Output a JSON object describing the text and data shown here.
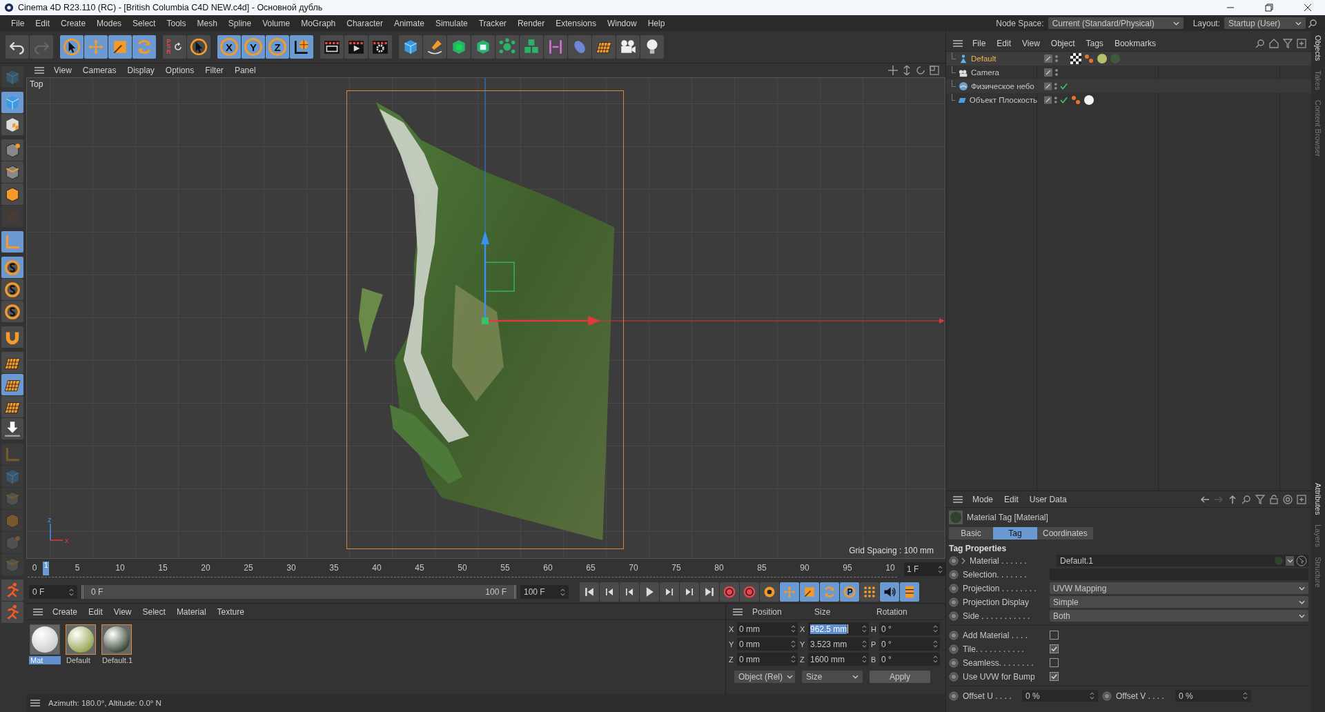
{
  "window": {
    "title": "Cinema 4D R23.110 (RC) - [British Columbia C4D NEW.c4d] - Основной дубль"
  },
  "menu": [
    "File",
    "Edit",
    "Create",
    "Modes",
    "Select",
    "Tools",
    "Mesh",
    "Spline",
    "Volume",
    "MoGraph",
    "Character",
    "Animate",
    "Simulate",
    "Tracker",
    "Render",
    "Extensions",
    "Window",
    "Help"
  ],
  "node_space": {
    "label": "Node Space:",
    "value": "Current (Standard/Physical)"
  },
  "layout": {
    "label": "Layout:",
    "value": "Startup (User)"
  },
  "toolbar": [
    [
      {
        "kind": "undo",
        "selected": false
      },
      {
        "kind": "redo",
        "selected": false
      }
    ],
    [
      {
        "kind": "cursor",
        "selected": true
      },
      {
        "kind": "move",
        "selected": true
      },
      {
        "kind": "scale",
        "selected": true
      },
      {
        "kind": "rotate",
        "selected": true
      }
    ],
    [
      {
        "kind": "psr",
        "label": "PSR",
        "selected": false
      },
      {
        "kind": "cursor",
        "selected": false
      }
    ],
    [
      {
        "kind": "axis",
        "label": "X",
        "selected": true
      },
      {
        "kind": "axis",
        "label": "Y",
        "selected": true
      },
      {
        "kind": "axis",
        "label": "Z",
        "selected": true
      },
      {
        "kind": "globe",
        "selected": true
      }
    ],
    [
      {
        "kind": "clapper",
        "selected": false
      },
      {
        "kind": "play-clapper",
        "selected": false
      },
      {
        "kind": "gear-clapper",
        "selected": false
      }
    ],
    [
      {
        "kind": "cube",
        "selected": false
      },
      {
        "kind": "pen",
        "selected": false
      },
      {
        "kind": "cube-frame",
        "selected": false
      },
      {
        "kind": "green-box",
        "selected": false
      },
      {
        "kind": "nodes",
        "selected": false
      },
      {
        "kind": "cubes",
        "selected": false
      },
      {
        "kind": "bar",
        "selected": false
      },
      {
        "kind": "blob",
        "selected": false
      },
      {
        "kind": "grid",
        "selected": false
      },
      {
        "kind": "camera",
        "selected": false
      },
      {
        "kind": "bulb",
        "selected": false
      }
    ]
  ],
  "left_toolbar": [
    [
      {
        "kind": "cube",
        "selected": false,
        "disabled": true
      }
    ],
    [
      {
        "kind": "cube",
        "selected": true,
        "disabled": false
      },
      {
        "kind": "checker",
        "selected": false,
        "disabled": false
      }
    ],
    [
      {
        "kind": "point",
        "selected": false,
        "disabled": false
      },
      {
        "kind": "edge",
        "selected": false,
        "disabled": false
      },
      {
        "kind": "face",
        "selected": false,
        "disabled": false
      },
      {
        "kind": "uv",
        "selected": false,
        "disabled": true
      }
    ],
    [
      {
        "kind": "axis",
        "selected": true,
        "disabled": false
      }
    ],
    [
      {
        "kind": "snap",
        "selected": true,
        "disabled": false
      },
      {
        "kind": "snap",
        "selected": false,
        "disabled": false
      },
      {
        "kind": "snap",
        "selected": false,
        "disabled": false
      }
    ],
    [
      {
        "kind": "magnet",
        "selected": false,
        "disabled": false
      }
    ],
    [
      {
        "kind": "grid",
        "selected": false,
        "disabled": false
      },
      {
        "kind": "grid",
        "selected": true,
        "disabled": false
      },
      {
        "kind": "grid",
        "selected": false,
        "disabled": false
      },
      {
        "kind": "drop",
        "selected": false,
        "disabled": false
      }
    ],
    [
      {
        "kind": "axis",
        "selected": false,
        "disabled": true
      },
      {
        "kind": "cube",
        "selected": false,
        "disabled": true
      },
      {
        "kind": "edge",
        "selected": false,
        "disabled": true
      },
      {
        "kind": "face",
        "selected": false,
        "disabled": true
      },
      {
        "kind": "point",
        "selected": false,
        "disabled": true
      },
      {
        "kind": "edge",
        "selected": false,
        "disabled": true
      }
    ],
    [
      {
        "kind": "runner",
        "selected": false,
        "disabled": false
      },
      {
        "kind": "runner",
        "selected": false,
        "disabled": false
      }
    ]
  ],
  "viewport": {
    "menu": [
      "View",
      "Cameras",
      "Display",
      "Options",
      "Filter",
      "Panel"
    ],
    "name": "Top",
    "grid_spacing": "Grid Spacing : 100 mm",
    "axis_labels": [
      "z",
      "x"
    ]
  },
  "timeline": {
    "ticks": [
      "0",
      "5",
      "10",
      "15",
      "20",
      "25",
      "30",
      "35",
      "40",
      "45",
      "50",
      "55",
      "60",
      "65",
      "70",
      "75",
      "80",
      "85",
      "90",
      "95",
      "10"
    ],
    "current": "1",
    "current_field": "1 F",
    "start": "0 F",
    "range_start": "0 F",
    "range_end": "100 F",
    "level": 1,
    "end": "100 F",
    "transport": [
      {
        "kind": "first",
        "selected": false
      },
      {
        "kind": "prev-key",
        "selected": false
      },
      {
        "kind": "prev",
        "selected": false
      },
      {
        "kind": "play",
        "selected": false
      },
      {
        "kind": "next",
        "selected": false
      },
      {
        "kind": "next-key",
        "selected": false
      },
      {
        "kind": "last",
        "selected": false
      },
      {
        "kind": "record",
        "selected": false
      },
      {
        "kind": "auto-key",
        "selected": false
      },
      {
        "kind": "key-gear",
        "selected": false
      },
      {
        "kind": "key-move",
        "selected": true
      },
      {
        "kind": "key-scale",
        "selected": true
      },
      {
        "kind": "key-rotate",
        "selected": true
      },
      {
        "kind": "key-p",
        "selected": true
      },
      {
        "kind": "key-dots",
        "selected": false
      },
      {
        "kind": "sound",
        "selected": true
      },
      {
        "kind": "film",
        "selected": true
      }
    ]
  },
  "materials": {
    "menu": [
      "Create",
      "Edit",
      "View",
      "Select",
      "Material",
      "Texture"
    ],
    "items": [
      {
        "name": "Mat",
        "kind": "white",
        "selected": true,
        "in_use": false
      },
      {
        "name": "Default",
        "kind": "yellow",
        "selected": false,
        "in_use": true
      },
      {
        "name": "Default.1",
        "kind": "green",
        "selected": false,
        "in_use": true
      }
    ]
  },
  "coordinates": {
    "headers": [
      "Position",
      "Size",
      "Rotation"
    ],
    "rows": [
      [
        {
          "axis": "X",
          "value": "0 mm",
          "focused": false
        },
        {
          "axis": "X",
          "value": "962.5 mm",
          "focused": true
        },
        {
          "axis": "H",
          "value": "0 °",
          "focused": false
        }
      ],
      [
        {
          "axis": "Y",
          "value": "0 mm",
          "focused": false
        },
        {
          "axis": "Y",
          "value": "3.523 mm",
          "focused": false
        },
        {
          "axis": "P",
          "value": "0 °",
          "focused": false
        }
      ],
      [
        {
          "axis": "Z",
          "value": "0 mm",
          "focused": false
        },
        {
          "axis": "Z",
          "value": "1600 mm",
          "focused": false
        },
        {
          "axis": "B",
          "value": "0 °",
          "focused": false
        }
      ]
    ],
    "mode": "Object (Rel)",
    "size_mode": "Size",
    "apply": "Apply"
  },
  "objects": {
    "menu": [
      "File",
      "Edit",
      "View",
      "Object",
      "Tags",
      "Bookmarks"
    ],
    "items": [
      {
        "name": "Default",
        "kind": "figure",
        "selected": true,
        "checked": false,
        "tags": [
          {
            "kind": "checker"
          },
          {
            "kind": "dots"
          },
          {
            "kind": "yellow"
          },
          {
            "kind": "green"
          }
        ]
      },
      {
        "name": "Camera",
        "kind": "camera",
        "selected": false,
        "checked": false
      },
      {
        "name": "Физическое небо",
        "kind": "sky",
        "selected": false,
        "checked": true
      },
      {
        "name": "Объект Плоскость",
        "kind": "plane",
        "selected": false,
        "checked": true,
        "tags": [
          {
            "kind": "dots"
          },
          {
            "kind": "white"
          }
        ]
      }
    ]
  },
  "attributes": {
    "menu": [
      "Mode",
      "Edit",
      "User Data"
    ],
    "title": "Material Tag [Material]",
    "tabs": [
      {
        "label": "Basic",
        "selected": false
      },
      {
        "label": "Tag",
        "selected": true
      },
      {
        "label": "Coordinates",
        "selected": false
      }
    ],
    "section": "Tag Properties",
    "fields": [
      {
        "kind": "link",
        "label": "Material . . . . . .",
        "value": "Default.1"
      },
      {
        "kind": "text",
        "label": "Selection. . . . . . ."
      },
      {
        "kind": "dropdown",
        "label": "Projection . . . . . . . .",
        "value": "UVW Mapping"
      },
      {
        "kind": "dropdown",
        "label": "Projection Display",
        "value": "Simple"
      },
      {
        "kind": "dropdown",
        "label": "Side . . . . . . . . . . .",
        "value": "Both"
      },
      {
        "kind": "checkbox",
        "label": "Add Material . . . .",
        "checked": false
      },
      {
        "kind": "checkbox",
        "label": "Tile. . . . . . . . . . .",
        "checked": true
      },
      {
        "kind": "checkbox",
        "label": "Seamless. . . . . . . .",
        "checked": false
      },
      {
        "kind": "checkbox",
        "label": "Use UVW for Bump",
        "checked": true
      },
      {
        "kind": "pair",
        "label": "Offset U . . . .",
        "value": "0 %",
        "label2": "Offset V . . . .",
        "value2": "0 %"
      }
    ]
  },
  "side_tabs_top": [
    "Objects",
    "Takes",
    "Content Browser"
  ],
  "side_tabs_bottom": [
    "Attributes",
    "Layers",
    "Structure"
  ],
  "status": "Azimuth: 180.0°, Altitude: 0.0°  N"
}
